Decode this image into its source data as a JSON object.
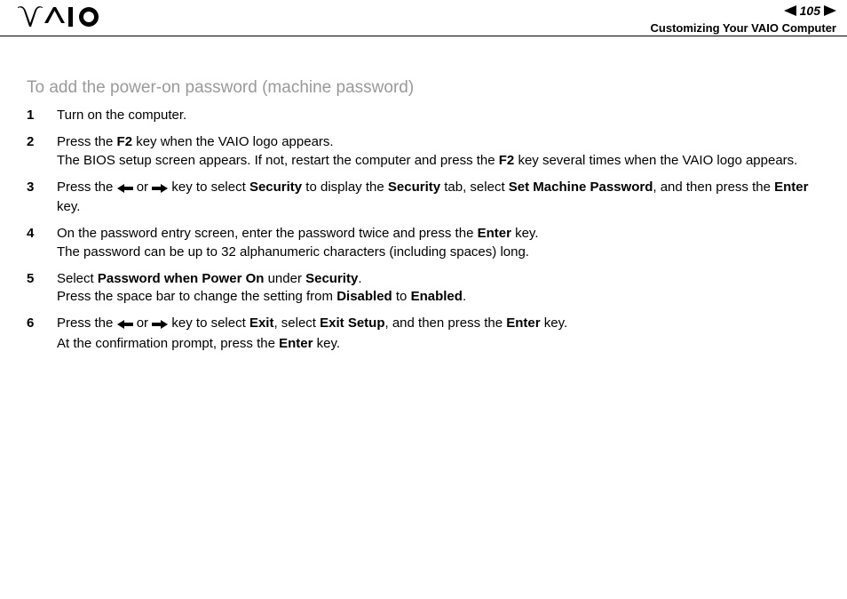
{
  "header": {
    "page_number": "105",
    "subtitle": "Customizing Your VAIO Computer"
  },
  "heading": "To add the power-on password (machine password)",
  "w": {
    "f2": "F2",
    "security": "Security",
    "set_machine_password": "Set Machine Password",
    "enter": "Enter",
    "password_when_power_on": "Password when Power On",
    "disabled": "Disabled",
    "enabled": "Enabled",
    "exit": "Exit",
    "exit_setup": "Exit Setup"
  },
  "steps": {
    "s1": "Turn on the computer.",
    "s2a": "Press the ",
    "s2b": " key when the VAIO logo appears.",
    "s2c": "The BIOS setup screen appears. If not, restart the computer and press the ",
    "s2d": " key several times when the VAIO logo appears.",
    "s3a": "Press the ",
    "s3or": " or ",
    "s3b": " key to select ",
    "s3c": " to display the ",
    "s3d": " tab, select ",
    "s3e": ", and then press the ",
    "s3f": " key.",
    "s4a": "On the password entry screen, enter the password twice and press the ",
    "s4b": " key.",
    "s4c": "The password can be up to 32 alphanumeric characters (including spaces) long.",
    "s5a": "Select ",
    "s5b": " under ",
    "s5c": ".",
    "s5d": "Press the space bar to change the setting from ",
    "s5e": " to ",
    "s6a": "Press the ",
    "s6b": " key to select ",
    "s6c": ", select ",
    "s6d": ", and then press the ",
    "s6e": " key.",
    "s6f": "At the confirmation prompt, press the ",
    "s6g": " key."
  }
}
